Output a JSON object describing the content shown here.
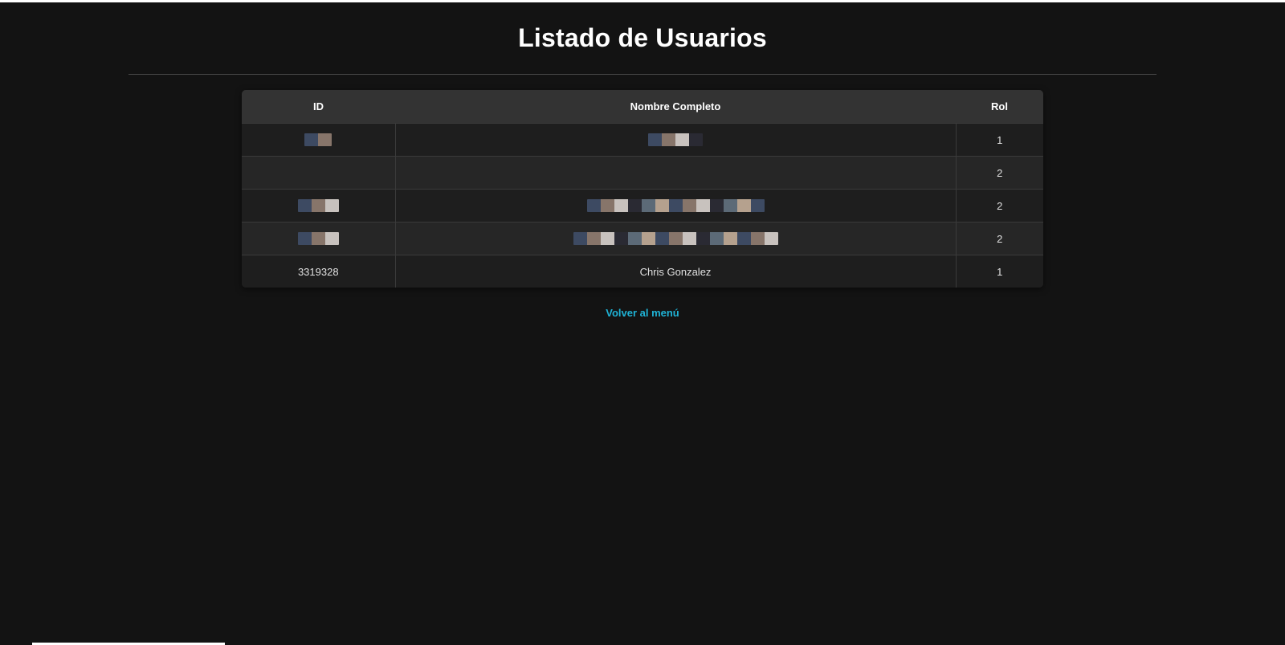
{
  "page": {
    "title": "Listado de Usuarios",
    "back_link": "Volver al menú"
  },
  "table": {
    "headers": {
      "id": "ID",
      "name": "Nombre Completo",
      "rol": "Rol"
    },
    "rows": [
      {
        "id": "",
        "name": "",
        "rol": "1",
        "redacted": true
      },
      {
        "id": "",
        "name": "",
        "rol": "2",
        "redacted": true
      },
      {
        "id": "",
        "name": "",
        "rol": "2",
        "redacted": true
      },
      {
        "id": "",
        "name": "",
        "rol": "2",
        "redacted": true
      },
      {
        "id": "3319328",
        "name": "Chris Gonzalez",
        "rol": "1",
        "redacted": false
      }
    ]
  },
  "colors": {
    "background": "#131313",
    "header_bg": "#333333",
    "link": "#1fb3d6"
  }
}
